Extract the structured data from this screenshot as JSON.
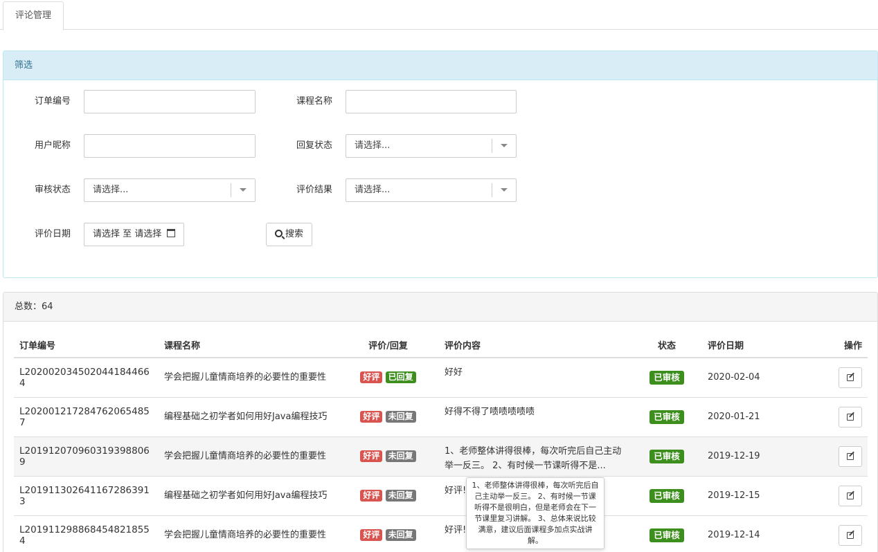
{
  "tabs": [
    {
      "label": "评论管理"
    }
  ],
  "filter": {
    "title": "筛选",
    "order_no_label": "订单编号",
    "order_no_value": "",
    "course_label": "课程名称",
    "course_value": "",
    "nickname_label": "用户昵称",
    "nickname_value": "",
    "reply_status_label": "回复状态",
    "reply_status_value": "请选择...",
    "audit_status_label": "审核状态",
    "audit_status_value": "请选择...",
    "result_label": "评价结果",
    "result_value": "请选择...",
    "date_label": "评价日期",
    "date_from": "请选择",
    "date_sep": "至",
    "date_to": "请选择",
    "search_label": "搜索"
  },
  "list": {
    "total_text": "总数：64",
    "columns": [
      "订单编号",
      "课程名称",
      "评价/回复",
      "评价内容",
      "状态",
      "评价日期",
      "操作"
    ],
    "rows": [
      {
        "order": "L202002034502044184466​4",
        "course": "学会把握儿童情商培养的必要性的重要性",
        "rating": "好评",
        "reply": "已回复",
        "content": "好好",
        "status": "已审核",
        "date": "2020-02-04"
      },
      {
        "order": "L202001217284762065485​7",
        "course": "编程基础之初学者如何用好Java编程技巧",
        "rating": "好评",
        "reply": "未回复",
        "content": "好得不得了啧啧啧啧啧",
        "status": "已审核",
        "date": "2020-01-21"
      },
      {
        "order": "L201912070960319398806​9",
        "course": "学会把握儿童情商培养的必要性的重要性",
        "rating": "好评",
        "reply": "未回复",
        "content": "1、老师整体讲得很棒，每次听完后自己主动举一反三。 2、有时候一节课听得不是...",
        "status": "已审核",
        "date": "2019-12-19"
      },
      {
        "order": "L201911302641167286391​3",
        "course": "编程基础之初学者如何用好Java编程技巧",
        "rating": "好评",
        "reply": "未回复",
        "content": "好评!",
        "status": "已审核",
        "date": "2019-12-15"
      },
      {
        "order": "L201911298868454821855​4",
        "course": "学会把握儿童情商培养的必要性的重要性",
        "rating": "好评",
        "reply": "未回复",
        "content": "好评!",
        "status": "已审核",
        "date": "2019-12-14"
      }
    ]
  },
  "tooltip": {
    "text": "1、老师整体讲得很棒，每次听完后自己主动举一反三。 2、有时候一节课听得不是很明白，但是老师会在下一节课里复习讲解。 3、总体来说比较满意，建议后面课程多加点实战讲解。"
  },
  "colors": {
    "good": "#d9534f",
    "replied": "#3c8f1c",
    "unreplied": "#777777",
    "audited": "#3c8f1c",
    "filter_header": "#d9edf7"
  }
}
